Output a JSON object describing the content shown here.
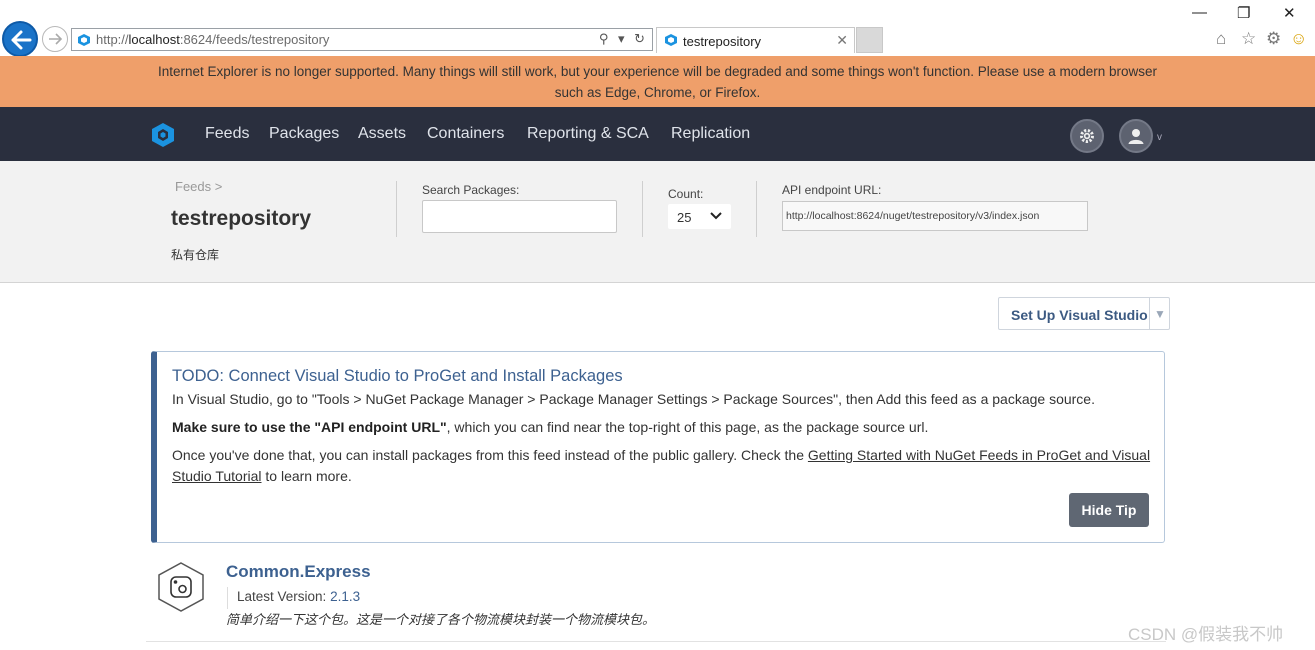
{
  "browser": {
    "url_prefix": "http://",
    "url_host": "localhost",
    "url_rest": ":8624/feeds/testrepository",
    "addr_tools": "⚲ ▾ ↻",
    "tab_title": "testrepository",
    "tab_close": "✕",
    "window_controls": {
      "minimize": "—",
      "restore": "❐",
      "close": "✕"
    },
    "toolbar_icons": {
      "home": "⌂",
      "favorites": "☆",
      "settings": "⚙",
      "feedback": "☺"
    }
  },
  "banner": {
    "text": "Internet Explorer is no longer supported. Many things will still work, but your experience will be degraded and some things won't function. Please use a modern browser such as Edge, Chrome, or Firefox."
  },
  "nav": {
    "items": [
      "Feeds",
      "Packages",
      "Assets",
      "Containers",
      "Reporting & SCA",
      "Replication"
    ],
    "user_caret": "v"
  },
  "header": {
    "breadcrumb": "Feeds >",
    "title": "testrepository",
    "description": "私有仓库",
    "search_label": "Search Packages:",
    "search_value": "",
    "count_label": "Count:",
    "count_value": "25",
    "api_label": "API endpoint URL:",
    "api_value": "http://localhost:8624/nuget/testrepository/v3/index.json"
  },
  "setup_button": {
    "label": "Set Up Visual Studio",
    "caret": "▼"
  },
  "tip": {
    "title": "TODO: Connect Visual Studio to ProGet and Install Packages",
    "line1": "In Visual Studio, go to \"Tools > NuGet Package Manager > Package Manager Settings > Package Sources\", then Add this feed as a package source.",
    "line2_bold": "Make sure to use the \"API endpoint URL\"",
    "line2_rest": ", which you can find near the top-right of this page, as the package source url.",
    "line3_pre": "Once you've done that, you can install packages from this feed instead of the public gallery. Check the ",
    "line3_link": "Getting Started with NuGet Feeds in ProGet and Visual Studio Tutorial",
    "line3_post": " to learn more.",
    "hide_label": "Hide Tip"
  },
  "package": {
    "name": "Common.Express",
    "version_label": "Latest Version: ",
    "version": "2.1.3",
    "description": "简单介绍一下这个包。这是一个对接了各个物流模块封装一个物流模块包。"
  },
  "watermark": "CSDN @假装我不帅",
  "colors": {
    "banner": "#ef9f6a",
    "nav_bg": "#2a2f3e",
    "accent": "#3d6190",
    "logo": "#1b93e0"
  }
}
